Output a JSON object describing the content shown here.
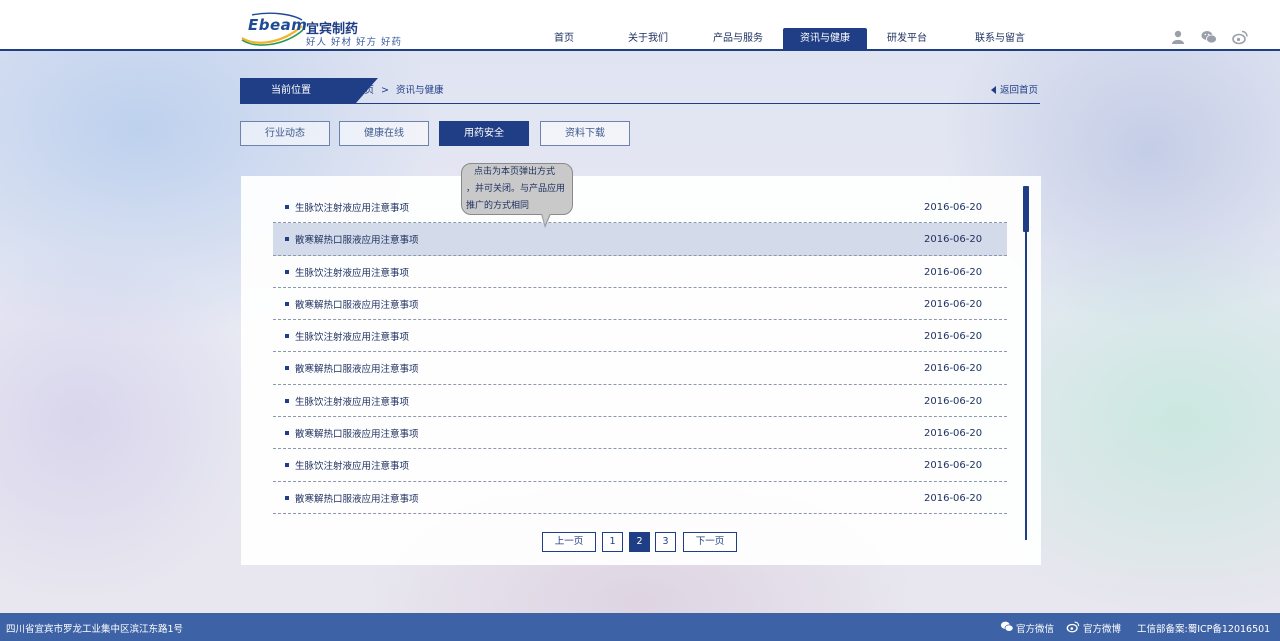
{
  "brand": {
    "en": "Ebeam",
    "cn": "宜宾制药",
    "slogan": "好人 好材  好方  好药"
  },
  "nav": [
    {
      "label": "首页"
    },
    {
      "label": "关于我们"
    },
    {
      "label": "产品与服务"
    },
    {
      "label": "资讯与健康",
      "active": true
    },
    {
      "label": "研发平台"
    },
    {
      "label": "联系与留言"
    }
  ],
  "header_icons": [
    "user-icon",
    "wechat-icon",
    "weibo-icon"
  ],
  "breadcrumb": {
    "tab_label": "当前位置",
    "path": [
      "首页",
      "资讯与健康"
    ],
    "separator": ">",
    "back_label": "返回首页"
  },
  "categories": [
    {
      "label": "行业动态"
    },
    {
      "label": "健康在线"
    },
    {
      "label": "用药安全",
      "active": true
    },
    {
      "label": "资料下载"
    }
  ],
  "articles": [
    {
      "title": "生脉饮注射液应用注意事项",
      "date": "2016-06-20"
    },
    {
      "title": "散寒解热口服液应用注意事项",
      "date": "2016-06-20"
    },
    {
      "title": "生脉饮注射液应用注意事项",
      "date": "2016-06-20"
    },
    {
      "title": "散寒解热口服液应用注意事项",
      "date": "2016-06-20"
    },
    {
      "title": "生脉饮注射液应用注意事项",
      "date": "2016-06-20"
    },
    {
      "title": "散寒解热口服液应用注意事项",
      "date": "2016-06-20"
    },
    {
      "title": "生脉饮注射液应用注意事项",
      "date": "2016-06-20"
    },
    {
      "title": "散寒解热口服液应用注意事项",
      "date": "2016-06-20"
    },
    {
      "title": "生脉饮注射液应用注意事项",
      "date": "2016-06-20"
    },
    {
      "title": "散寒解热口服液应用注意事项",
      "date": "2016-06-20"
    }
  ],
  "hovered_row": 2,
  "pagination": {
    "prev": "上一页",
    "pages": [
      "1",
      "2",
      "3"
    ],
    "current": "2",
    "next": "下一页"
  },
  "tooltip": {
    "line1": "点击为本页弹出方式",
    "line2": "，并可关闭。与产品应用",
    "line3": "推广的方式相同"
  },
  "footer": {
    "address": "四川省宜宾市罗龙工业集中区滨江东路1号",
    "wechat_label": "官方微信",
    "weibo_label": "官方微博",
    "icp": "工信部备案:蜀ICP备12016501"
  },
  "colors": {
    "primary": "#1f3e86",
    "footer": "#3d63a6",
    "row_hover": "#d3dae9"
  }
}
